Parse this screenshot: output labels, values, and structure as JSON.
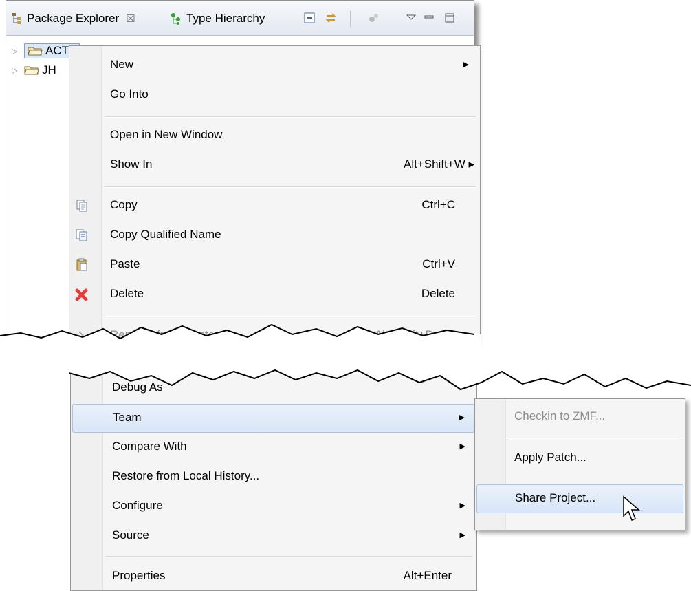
{
  "tabs": {
    "package_explorer": "Package Explorer",
    "package_explorer_close": "☒",
    "type_hierarchy": "Type Hierarchy"
  },
  "tree": {
    "items": [
      {
        "label": "ACTS"
      },
      {
        "label": "JH"
      }
    ]
  },
  "context_menu_top": {
    "new": "New",
    "go_into": "Go Into",
    "open_in_new_window": "Open in New Window",
    "show_in": "Show In",
    "show_in_shortcut": "Alt+Shift+W ▸",
    "copy": "Copy",
    "copy_shortcut": "Ctrl+C",
    "copy_qualified_name": "Copy Qualified Name",
    "paste": "Paste",
    "paste_shortcut": "Ctrl+V",
    "delete": "Delete",
    "delete_shortcut": "Delete",
    "remove_from_context": "Remove from Context",
    "remove_from_context_shortcut": "Ctrl+Alt+Shift+Down"
  },
  "context_menu_bottom": {
    "debug_as": "Debug As",
    "team": "Team",
    "compare_with": "Compare With",
    "restore_from_local_history": "Restore from Local History...",
    "configure": "Configure",
    "source": "Source",
    "properties": "Properties",
    "properties_shortcut": "Alt+Enter"
  },
  "team_submenu": {
    "checkin_to_zmf": "Checkin to ZMF...",
    "apply_patch": "Apply Patch...",
    "share_project": "Share Project..."
  },
  "colors": {
    "highlight": "#d9e6f7",
    "highlight_border": "#a8c4e8",
    "delete_icon": "#e0403a",
    "folder": "#f0c870"
  }
}
